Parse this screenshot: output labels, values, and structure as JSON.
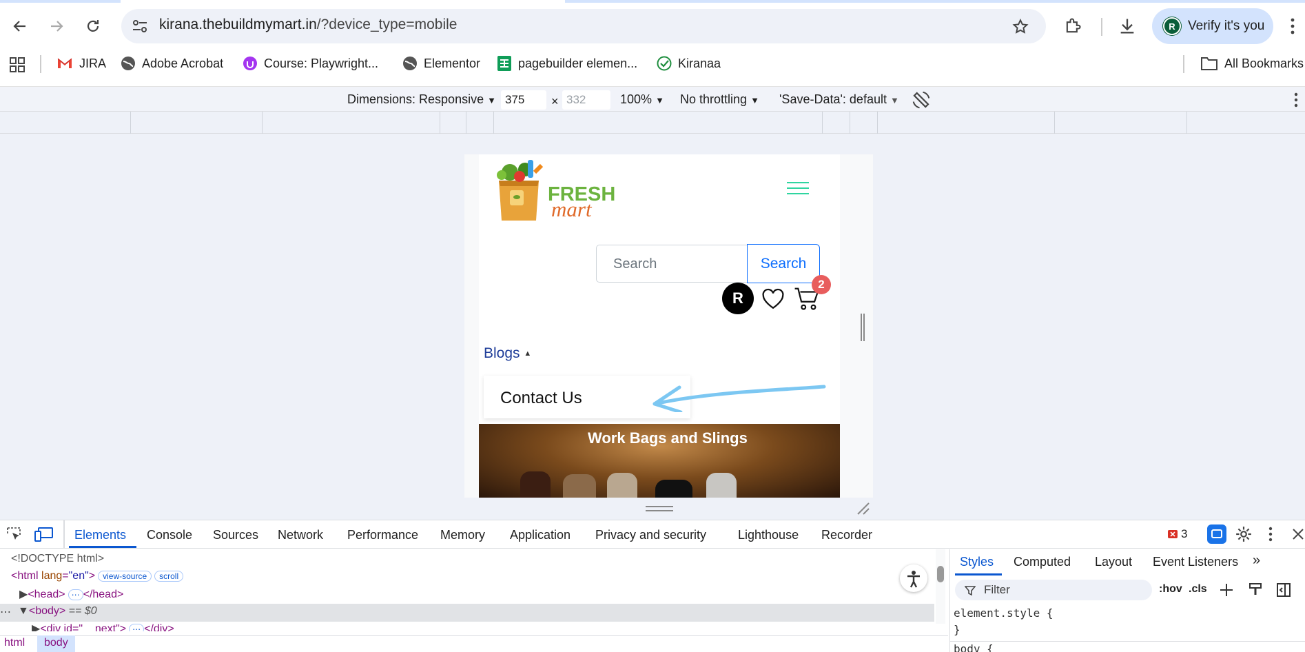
{
  "browser": {
    "url_host": "kirana.thebuildmymart.in",
    "url_path": "/?device_type=mobile",
    "profile_initial": "R",
    "profile_label": "Verify it's you"
  },
  "bookmarks": [
    {
      "label": "JIRA",
      "icon": "gmail-icon"
    },
    {
      "label": "Adobe Acrobat",
      "icon": "globe-icon"
    },
    {
      "label": "Course: Playwright...",
      "icon": "udemy-icon"
    },
    {
      "label": "Elementor",
      "icon": "globe-icon"
    },
    {
      "label": "pagebuilder elemen...",
      "icon": "sheets-icon"
    },
    {
      "label": "Kiranaa",
      "icon": "check-icon"
    }
  ],
  "all_bookmarks": "All Bookmarks",
  "device_toolbar": {
    "dimensions": "Dimensions: Responsive",
    "width": "375",
    "x": "×",
    "height_placeholder": "332",
    "zoom": "100%",
    "throttling": "No throttling",
    "save_data": "'Save-Data': default"
  },
  "site": {
    "logo_top": "FRESH",
    "logo_bottom": "mart",
    "search_placeholder": "Search",
    "search_button": "Search",
    "user_initial": "R",
    "cart_count": "2",
    "blogs": "Blogs",
    "contact": "Contact Us",
    "banner_title": "Work Bags and Slings"
  },
  "devtools": {
    "tabs": [
      "Elements",
      "Console",
      "Sources",
      "Network",
      "Performance",
      "Memory",
      "Application",
      "Privacy and security",
      "Lighthouse",
      "Recorder"
    ],
    "error_count": "3",
    "dom": {
      "doctype": "<!DOCTYPE html>",
      "html_open": "<html ",
      "lang_attr": "lang",
      "lang_val": "\"en\"",
      "html_close": ">",
      "view_source": "view-source",
      "scroll": "scroll",
      "head": "<head>",
      "head_close": "</head>",
      "body": "<body>",
      "body_eq": " == $0",
      "div": "<div id=\"__next\">",
      "div_close": "</div>"
    },
    "styles_tabs": [
      "Styles",
      "Computed",
      "Layout",
      "Event Listeners"
    ],
    "filter_placeholder": "Filter",
    "hov": ":hov",
    "cls": ".cls",
    "element_style": "element.style {",
    "brace_close": "}",
    "body_rule": "body {",
    "crumbs": [
      "html",
      "body"
    ]
  }
}
